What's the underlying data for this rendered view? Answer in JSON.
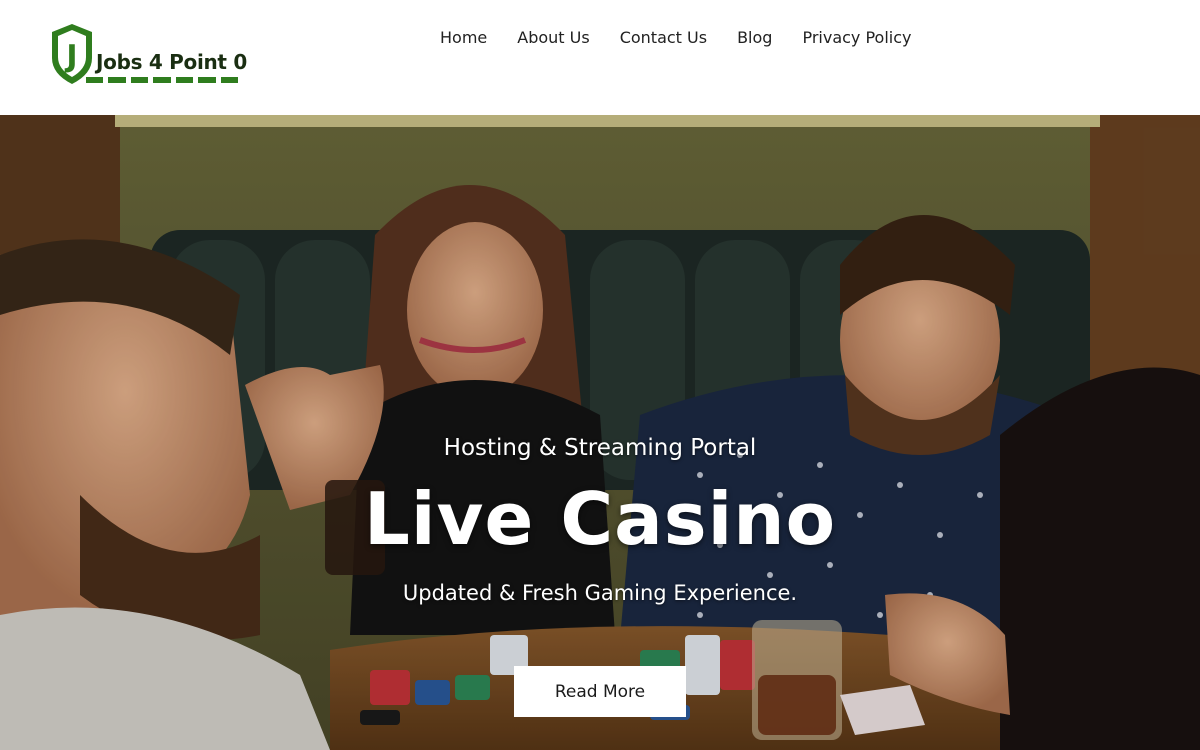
{
  "brand": {
    "logo_letter": "J",
    "name": "Jobs 4 Point 0",
    "color": "#2f7d1e"
  },
  "nav": {
    "items": [
      {
        "label": "Home"
      },
      {
        "label": "About Us"
      },
      {
        "label": "Contact Us"
      },
      {
        "label": "Blog"
      },
      {
        "label": "Privacy Policy"
      }
    ]
  },
  "hero": {
    "subtitle": "Hosting & Streaming Portal",
    "title": "Live Casino",
    "tagline": "Updated & Fresh Gaming Experience.",
    "cta_label": "Read More",
    "image_description_icon": "casino-photo"
  }
}
